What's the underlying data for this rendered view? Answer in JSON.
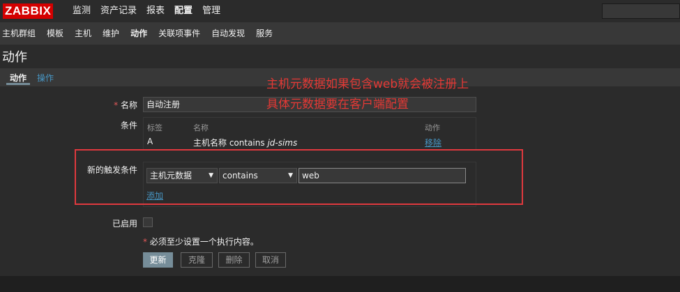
{
  "app": {
    "logo": "ZABBIX",
    "brand_color": "#d40000",
    "accent_color": "#768d99",
    "link_color": "#4796c4"
  },
  "top_menu": [
    "监测",
    "资产记录",
    "报表",
    "配置",
    "管理"
  ],
  "sub_menu": [
    "主机群组",
    "模板",
    "主机",
    "维护",
    "动作",
    "关联项事件",
    "自动发现",
    "服务"
  ],
  "page": {
    "title": "动作"
  },
  "tabs": {
    "action": "动作",
    "operations": "操作"
  },
  "form": {
    "name_label": "名称",
    "required_mark": "*",
    "name_value": "自动注册",
    "conditions_label": "条件",
    "conditions": {
      "headers": {
        "label": "标签",
        "name": "名称",
        "action": "动作"
      },
      "rows": [
        {
          "label": "A",
          "name_prefix": "主机名称 contains ",
          "name_value": "jd-sims",
          "action": "移除"
        }
      ]
    },
    "new_condition_label": "新的触发条件",
    "new_condition": {
      "type": "主机元数据",
      "operator": "contains",
      "value": "web",
      "add_link": "添加"
    },
    "enabled_label": "已启用",
    "enabled": false,
    "hint": "必须至少设置一个执行内容。"
  },
  "buttons": {
    "update": "更新",
    "clone": "克隆",
    "delete": "删除",
    "cancel": "取消"
  },
  "annotation": {
    "line1": "主机元数据如果包含web就会被注册上",
    "line2": "具体元数据要在客户端配置",
    "color": "#e53935"
  }
}
